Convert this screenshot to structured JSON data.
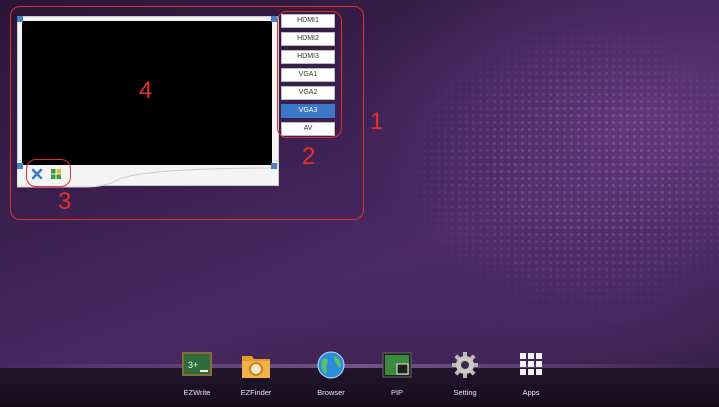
{
  "pip_window": {
    "sources": [
      {
        "label": "HDMI1",
        "selected": false
      },
      {
        "label": "HDMI2",
        "selected": false
      },
      {
        "label": "HDMI3",
        "selected": false
      },
      {
        "label": "VGA1",
        "selected": false
      },
      {
        "label": "VGA2",
        "selected": false
      },
      {
        "label": "VGA3",
        "selected": true
      },
      {
        "label": "AV",
        "selected": false
      }
    ],
    "close_icon": "close-icon",
    "layout_icon": "grid-layout-icon"
  },
  "callouts": {
    "c1": "1",
    "c2": "2",
    "c3": "3",
    "c4": "4",
    "color": "#e03030"
  },
  "dock": {
    "apps": [
      {
        "label": "EZWrite",
        "icon": "chalkboard-icon"
      },
      {
        "label": "EZFinder",
        "icon": "folder-search-icon"
      },
      {
        "label": "Browser",
        "icon": "globe-icon"
      },
      {
        "label": "PIP",
        "icon": "pip-icon"
      },
      {
        "label": "Setting",
        "icon": "gear-icon"
      },
      {
        "label": "Apps",
        "icon": "apps-grid-icon"
      }
    ]
  },
  "colors": {
    "accent": "#3c78c8",
    "callout": "#e03030"
  }
}
